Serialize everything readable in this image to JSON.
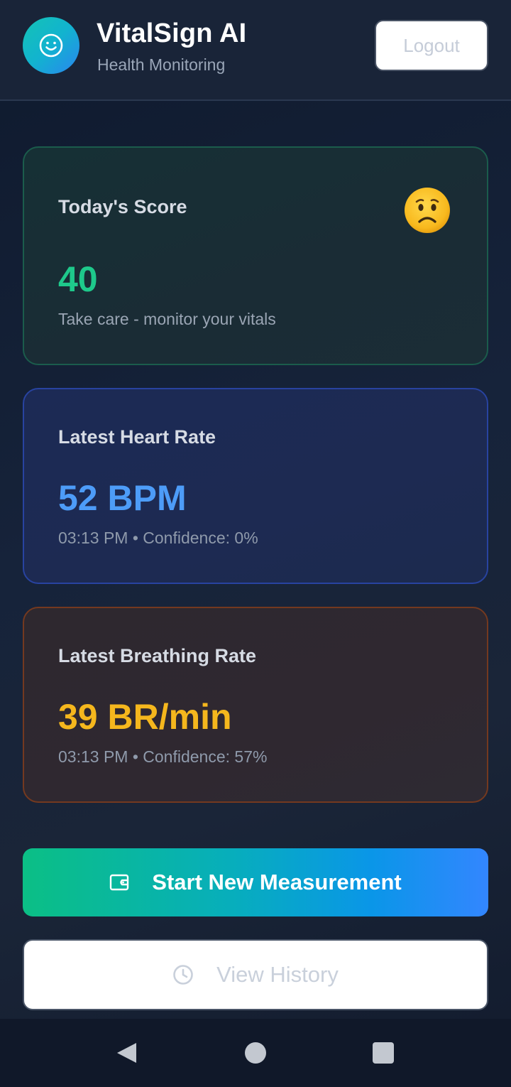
{
  "header": {
    "title": "VitalSign AI",
    "subtitle": "Health Monitoring",
    "logout_label": "Logout",
    "logo_icon": "smile-icon"
  },
  "score_card": {
    "label": "Today's Score",
    "value": "40",
    "message": "Take care - monitor your vitals",
    "value_color": "#1ec98b",
    "mood_icon": "worried-face-emoji"
  },
  "heart_card": {
    "label": "Latest Heart Rate",
    "value": "52 BPM",
    "meta": "03:13 PM • Confidence: 0%",
    "value_color": "#4d9cf8"
  },
  "breath_card": {
    "label": "Latest Breathing Rate",
    "value": "39 BR/min",
    "meta": "03:13 PM • Confidence: 57%",
    "value_color": "#f5b71d"
  },
  "actions": {
    "start_label": "Start New Measurement",
    "start_icon": "wallet-icon",
    "history_label": "View History",
    "history_icon": "clock-icon"
  },
  "navigation": {
    "back_icon": "back-triangle-icon",
    "home_icon": "home-circle-icon",
    "recent_icon": "recent-square-icon"
  }
}
